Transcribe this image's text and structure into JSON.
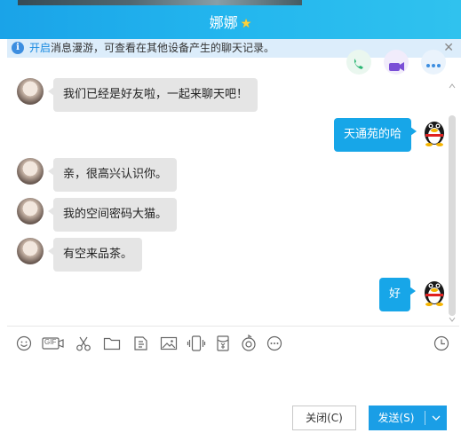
{
  "window": {
    "title": "娜娜"
  },
  "notice": {
    "link": "开启",
    "text": "消息漫游，可查看在其他设备产生的聊天记录。"
  },
  "messages": [
    {
      "side": "left",
      "text": "我们已经是好友啦，一起来聊天吧！"
    },
    {
      "side": "right",
      "text": "天通苑的哈"
    },
    {
      "side": "left",
      "text": "亲，很高兴认识你。"
    },
    {
      "side": "left",
      "text": "我的空间密码大猫。"
    },
    {
      "side": "left",
      "text": "有空来品茶。"
    },
    {
      "side": "right",
      "text": "好"
    }
  ],
  "toolbar": {
    "icons": [
      "emoji-icon",
      "gif-icon",
      "scissors-icon",
      "folder-icon",
      "doc-icon",
      "image-icon",
      "shake-icon",
      "red-packet-icon",
      "voice-icon",
      "more-icon",
      "history-icon"
    ],
    "gif_label": "GIF"
  },
  "buttons": {
    "close": "关闭(C)",
    "send": "发送(S)"
  },
  "colors": {
    "accent": "#1a9ee6",
    "bubble_right": "#17a6e8",
    "bubble_left": "#e5e5e5"
  }
}
